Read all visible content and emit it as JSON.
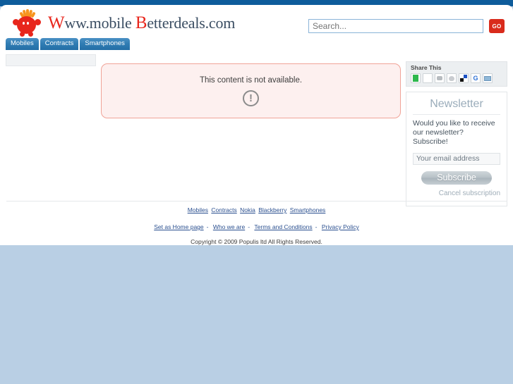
{
  "site": {
    "logo_prefix": "W",
    "logo_mid": "ww.mobile ",
    "logo_cap2": "B",
    "logo_suffix": "etterdeals.com",
    "logo_alt": "Www.mobile Betterdeals.com"
  },
  "search": {
    "value": "",
    "placeholder": "Search...",
    "button_label": "GO"
  },
  "nav": {
    "tabs": [
      {
        "label": "Mobiles"
      },
      {
        "label": "Contracts"
      },
      {
        "label": "Smartphones"
      }
    ]
  },
  "main": {
    "error_message": "This content is not available.",
    "error_icon": "exclamation-circle-icon"
  },
  "share": {
    "title": "Share This",
    "icons": [
      {
        "name": "wikio-share-icon",
        "class": "ic-green"
      },
      {
        "name": "oknotizie-share-icon",
        "class": "ic-green2"
      },
      {
        "name": "digg-share-icon",
        "class": "ic-gray"
      },
      {
        "name": "reddit-share-icon",
        "class": "ic-reddit"
      },
      {
        "name": "delicious-share-icon",
        "class": "ic-delic"
      },
      {
        "name": "google-share-icon",
        "class": "ic-google"
      },
      {
        "name": "email-share-icon",
        "class": "ic-mail"
      }
    ]
  },
  "newsletter": {
    "title": "Newsletter",
    "description": "Would you like to receive our newsletter? Subscribe!",
    "input_value": "Your email address",
    "input_placeholder": "Your email address",
    "subscribe_label": "Subscribe",
    "cancel_label": "Cancel subscription"
  },
  "footer": {
    "category_links": [
      {
        "label": "Mobiles"
      },
      {
        "label": "Contracts"
      },
      {
        "label": "Nokia"
      },
      {
        "label": "Blackberry"
      },
      {
        "label": "Smartphones"
      }
    ],
    "info_links": [
      {
        "label": "Set as Home page"
      },
      {
        "label": "Who we are"
      },
      {
        "label": "Terms and Conditions"
      },
      {
        "label": "Privacy Policy"
      }
    ],
    "separator": "-",
    "copyright": "Copyright © 2009 Populis ltd All Rights Reserved."
  },
  "colors": {
    "topbar": "#0e5c9b",
    "page_background": "#b9cfe4",
    "logo_accent": "#e8261c",
    "go_button": "#d92b1c",
    "error_bg": "#fdf0ef",
    "error_border": "#f0a397",
    "tab_blue": "#2f7cb3",
    "link_blue": "#2a4f8f"
  }
}
